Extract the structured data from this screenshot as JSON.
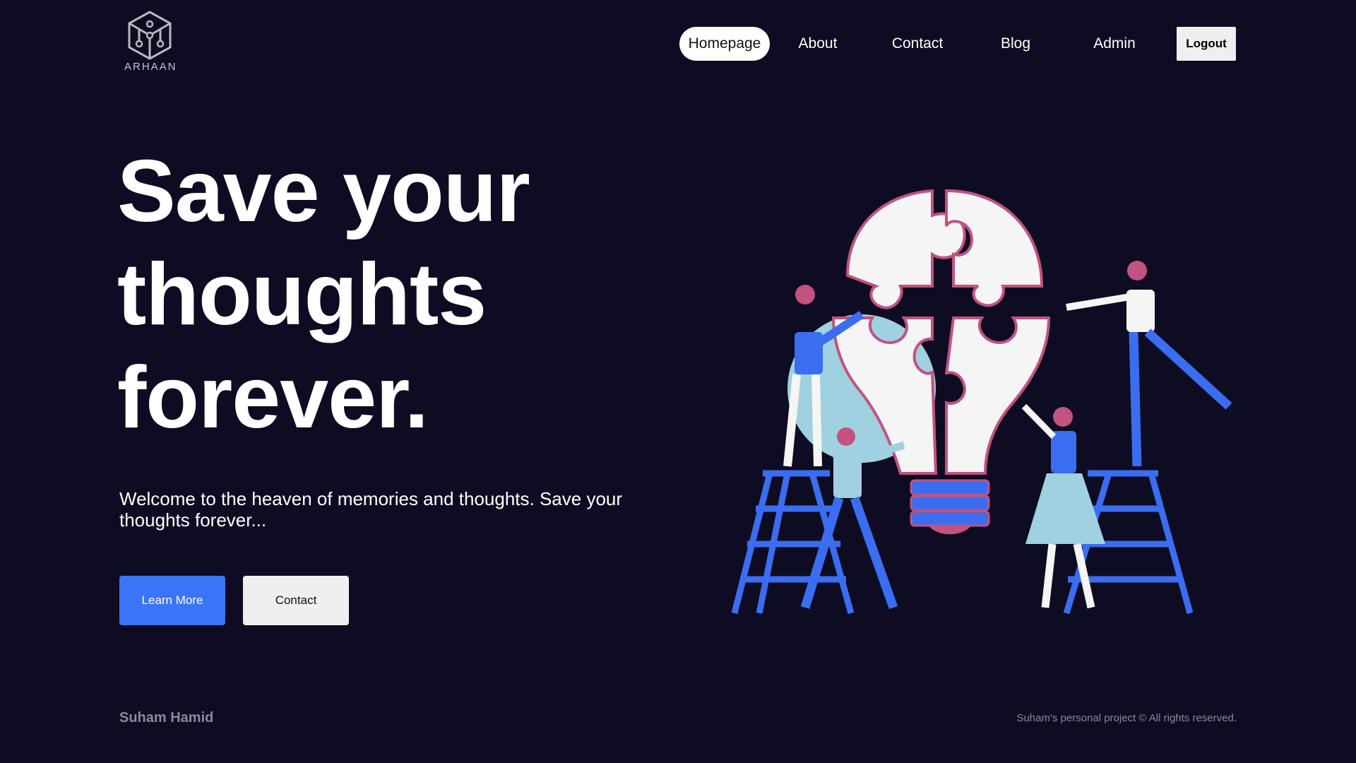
{
  "brand": {
    "logo_text": "ARHAAN",
    "logo_icon": "cube-network-icon"
  },
  "nav": {
    "items": [
      {
        "label": "Homepage",
        "active": true
      },
      {
        "label": "About",
        "active": false
      },
      {
        "label": "Contact",
        "active": false
      },
      {
        "label": "Blog",
        "active": false
      },
      {
        "label": "Admin",
        "active": false
      }
    ],
    "logout_label": "Logout"
  },
  "hero": {
    "title_lines": [
      "Save your",
      "thoughts",
      "forever."
    ],
    "subtitle": "Welcome to the heaven of memories and thoughts. Save your thoughts forever...",
    "primary_button": "Learn More",
    "secondary_button": "Contact",
    "illustration": "people-assembling-puzzle-lightbulb"
  },
  "footer": {
    "name": "Suham Hamid",
    "copyright": "Suham's personal project © All rights reserved."
  },
  "colors": {
    "background": "#0d0c22",
    "accent": "#3a74f7",
    "pink": "#c2527f",
    "light_blue": "#9fd1e0"
  }
}
